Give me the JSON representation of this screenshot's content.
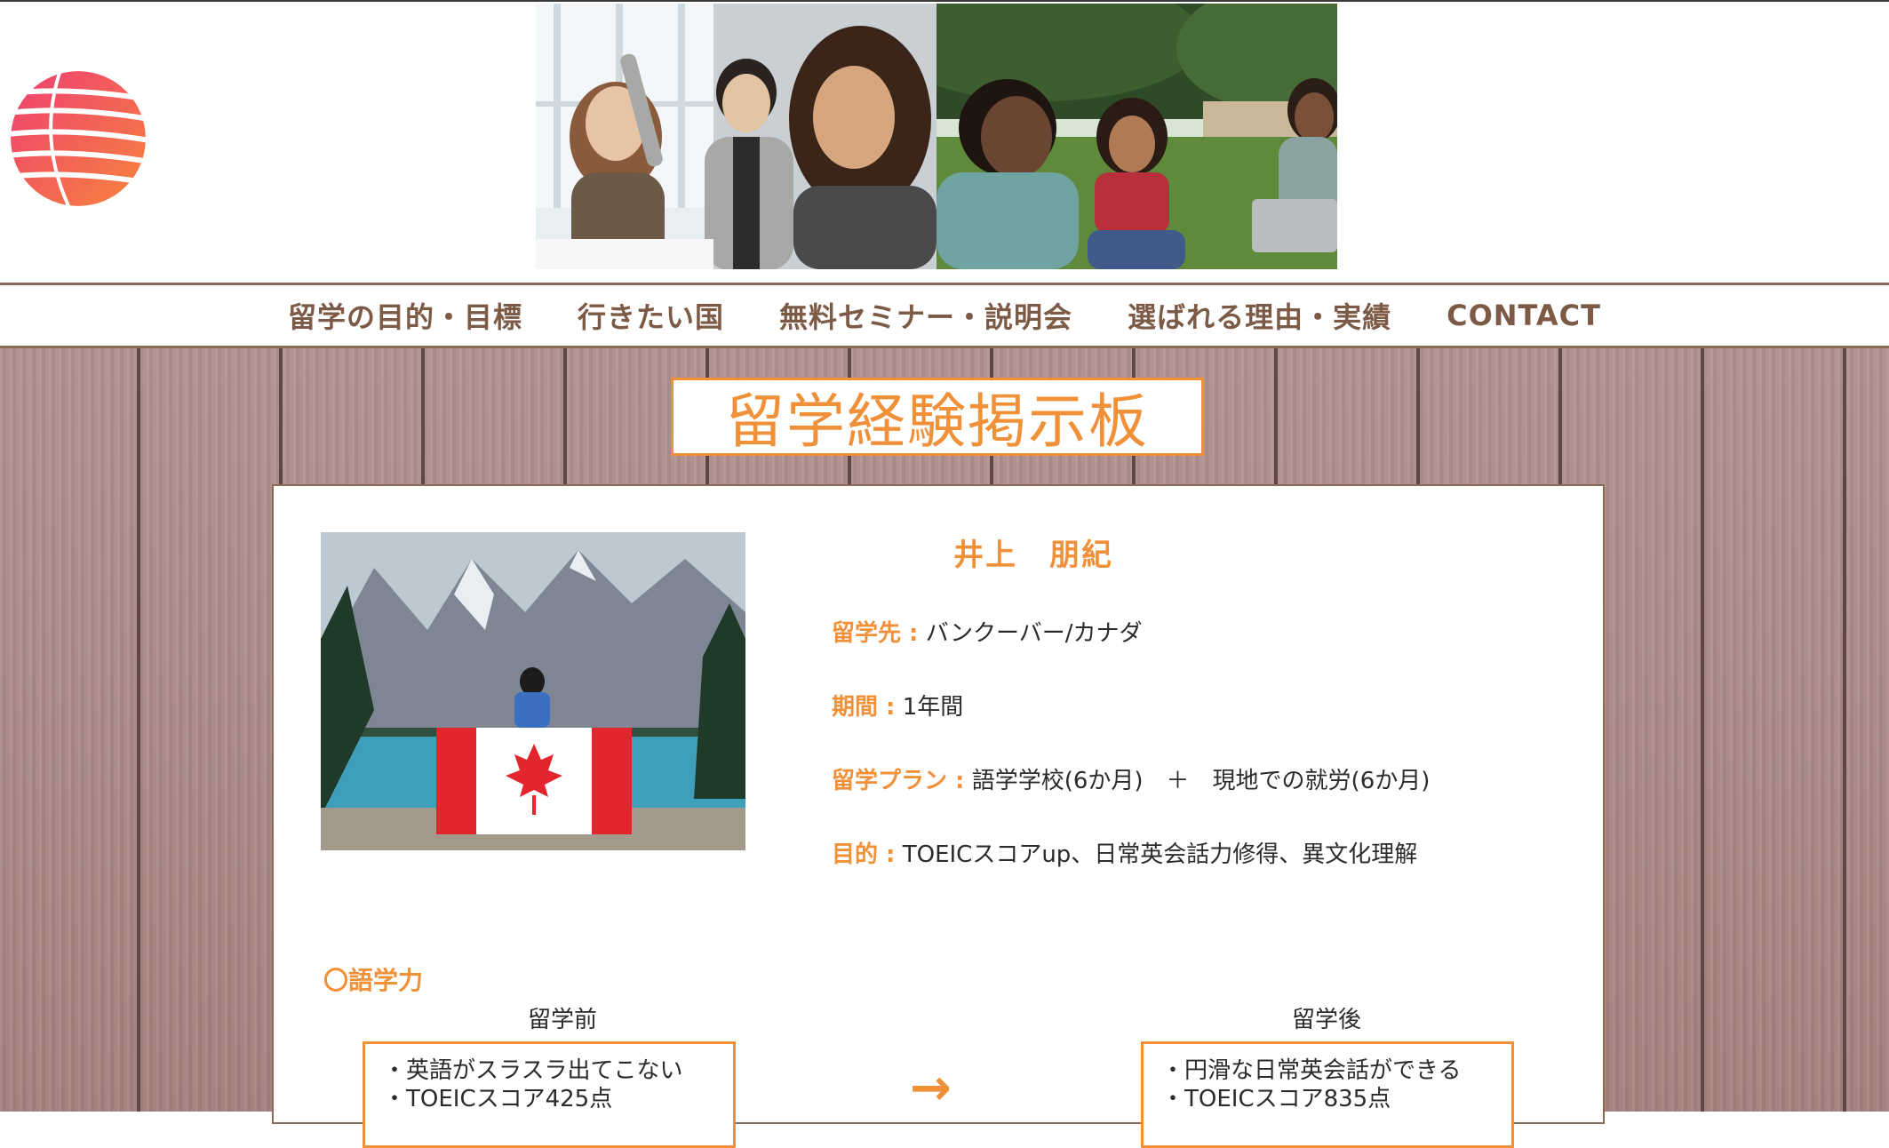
{
  "brand": {
    "logo_icon": "striped-globe-icon",
    "colors": {
      "logo_top": "#ef3f73",
      "logo_bottom": "#f7843c"
    }
  },
  "nav": {
    "items": [
      {
        "label": "留学の目的・目標"
      },
      {
        "label": "行きたい国"
      },
      {
        "label": "無料セミナー・説明会"
      },
      {
        "label": "選ばれる理由・実績"
      },
      {
        "label": "CONTACT"
      }
    ]
  },
  "board": {
    "title": "留学経験掲示板"
  },
  "profile": {
    "name": "井上　朋紀",
    "rows": [
      {
        "key": "留学先 :",
        "value": " バンクーバー/カナダ"
      },
      {
        "key": "期間 :",
        "value": " 1年間"
      },
      {
        "key": "留学プラン :",
        "value": " 語学学校(6か月)　＋　現地での就労(6か月)"
      },
      {
        "key": "目的 :",
        "value": " TOEICスコアup、日常英会話力修得、異文化理解"
      }
    ]
  },
  "language": {
    "heading": "〇語学力",
    "before": {
      "label": "留学前",
      "lines": [
        "・英語がスラスラ出てこない",
        "・TOEICスコア425点"
      ]
    },
    "arrow": "→",
    "after": {
      "label": "留学後",
      "lines": [
        "・円滑な日常英会話ができる",
        "・TOEICスコア835点"
      ]
    }
  },
  "colors": {
    "accent": "#f0913a",
    "nav_text": "#7c5a46",
    "wood": "#ae8e8a"
  }
}
